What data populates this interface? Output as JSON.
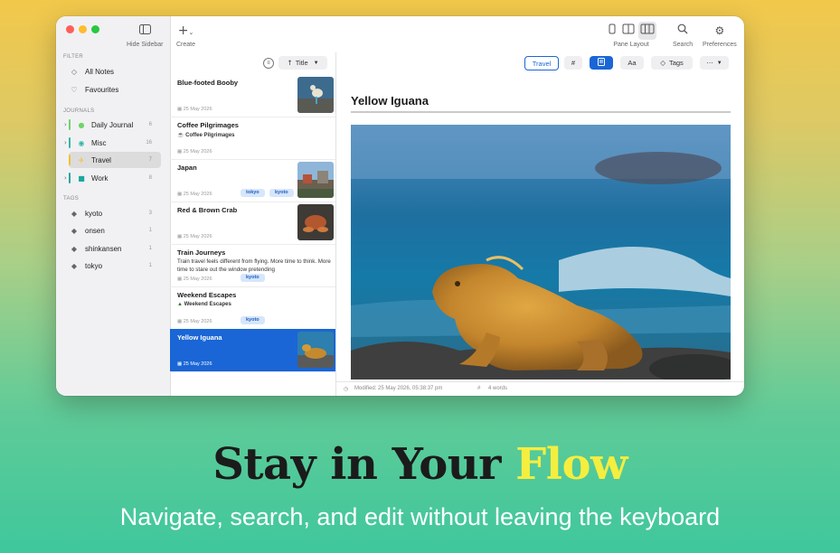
{
  "toolbar": {
    "hide_sidebar_label": "Hide Sidebar",
    "create_label": "Create",
    "pane_layout_label": "Pane Layout",
    "search_label": "Search",
    "preferences_label": "Preferences",
    "icons": [
      "sidebar-icon",
      "plus-icon",
      "single-pane-icon",
      "two-pane-icon",
      "three-pane-icon",
      "search-icon",
      "gear-icon"
    ]
  },
  "sidebar": {
    "filter_label": "FILTER",
    "all_notes": "All Notes",
    "favourites": "Favourites",
    "journals_label": "JOURNALS",
    "journals": [
      {
        "name": "Daily Journal",
        "count": "6",
        "color": "#6fd46b"
      },
      {
        "name": "Misc",
        "count": "16",
        "color": "#34b7a7"
      },
      {
        "name": "Travel",
        "count": "7",
        "color": "#f3c02f"
      },
      {
        "name": "Work",
        "count": "8",
        "color": "#1aa8a0"
      }
    ],
    "tags_label": "TAGS",
    "tags": [
      {
        "name": "kyoto",
        "count": "3"
      },
      {
        "name": "onsen",
        "count": "1"
      },
      {
        "name": "shinkansen",
        "count": "1"
      },
      {
        "name": "tokyo",
        "count": "1"
      }
    ]
  },
  "list": {
    "sort_label": "Title",
    "notes": [
      {
        "title": "Blue-footed Booby",
        "date": "25 May 2026"
      },
      {
        "title": "Coffee Pilgrimages",
        "subtitle": "Coffee Pilgrimages",
        "date": "25 May 2026"
      },
      {
        "title": "Japan",
        "date": "25 May 2026",
        "tags": [
          "tokyo",
          "kyoto"
        ]
      },
      {
        "title": "Red & Brown Crab",
        "date": "25 May 2026"
      },
      {
        "title": "Train Journeys",
        "excerpt": "Train travel feels different from flying. More time to think. More time to stare out the window pretending",
        "date": "25 May 2026",
        "tags": [
          "kyoto"
        ]
      },
      {
        "title": "Weekend Escapes",
        "subtitle": "Weekend Escapes",
        "date": "25 May 2026",
        "tags": [
          "kyoto"
        ]
      },
      {
        "title": "Yellow Iguana",
        "date": "25 May 2026"
      }
    ]
  },
  "editor": {
    "journal_chip": "Travel",
    "hash_label": "#",
    "font_label": "Aa",
    "tags_button": "Tags",
    "title": "Yellow Iguana",
    "status_modified": "Modified: 25 May 2026, 05:38:37 pm",
    "status_hash": "#",
    "status_words": "4 words"
  },
  "promo": {
    "headline_main": "Stay in Your",
    "headline_accent": "Flow",
    "subheadline": "Navigate, search, and edit without leaving the keyboard"
  },
  "colors": {
    "accent_blue": "#1a66d6",
    "headline_accent": "#f5ee3f"
  }
}
